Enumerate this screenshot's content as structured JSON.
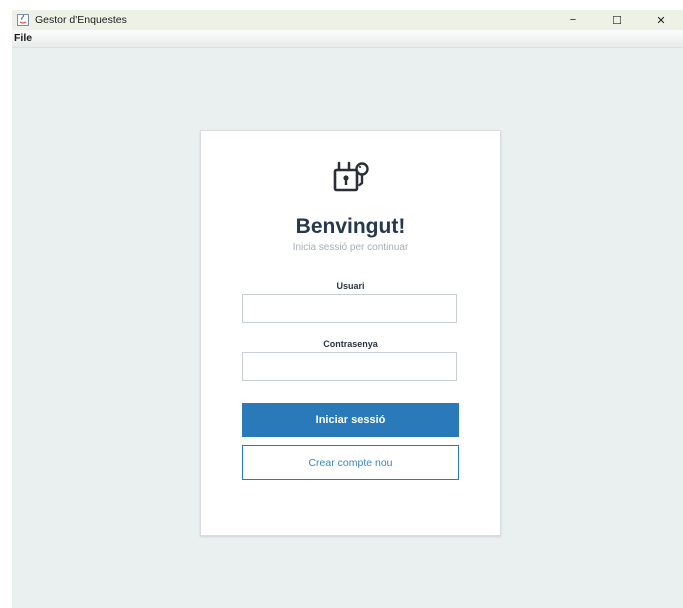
{
  "window": {
    "title": "Gestor d'Enquestes",
    "controls": {
      "minimize": "−",
      "maximize": "☐",
      "close": "✕"
    }
  },
  "menu": {
    "items": [
      {
        "label": "File"
      }
    ]
  },
  "login": {
    "icon": "lock-key-icon",
    "heading": "Benvingut!",
    "subheading": "Inicia sessió per continuar",
    "username_label": "Usuari",
    "username_value": "",
    "password_label": "Contrasenya",
    "password_value": "",
    "login_button": "Iniciar sessió",
    "create_account_button": "Crear compte nou"
  },
  "colors": {
    "accent": "#2a7ab9",
    "heading": "#26384d",
    "background": "#eaf0f0"
  }
}
